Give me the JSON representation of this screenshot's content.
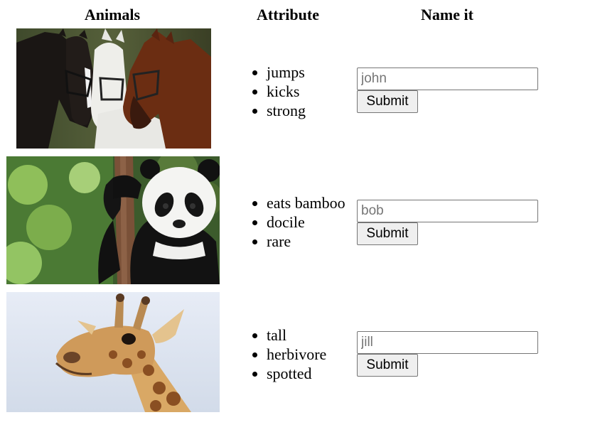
{
  "headers": {
    "animals": "Animals",
    "attribute": "Attribute",
    "name_it": "Name it"
  },
  "rows": [
    {
      "image": "horses-photo",
      "attributes": [
        "jumps",
        "kicks",
        "strong"
      ],
      "placeholder": "john",
      "submit_label": "Submit"
    },
    {
      "image": "panda-photo",
      "attributes": [
        "eats bamboo",
        "docile",
        "rare"
      ],
      "placeholder": "bob",
      "submit_label": "Submit"
    },
    {
      "image": "giraffe-photo",
      "attributes": [
        "tall",
        "herbivore",
        "spotted"
      ],
      "placeholder": "jill",
      "submit_label": "Submit"
    }
  ]
}
